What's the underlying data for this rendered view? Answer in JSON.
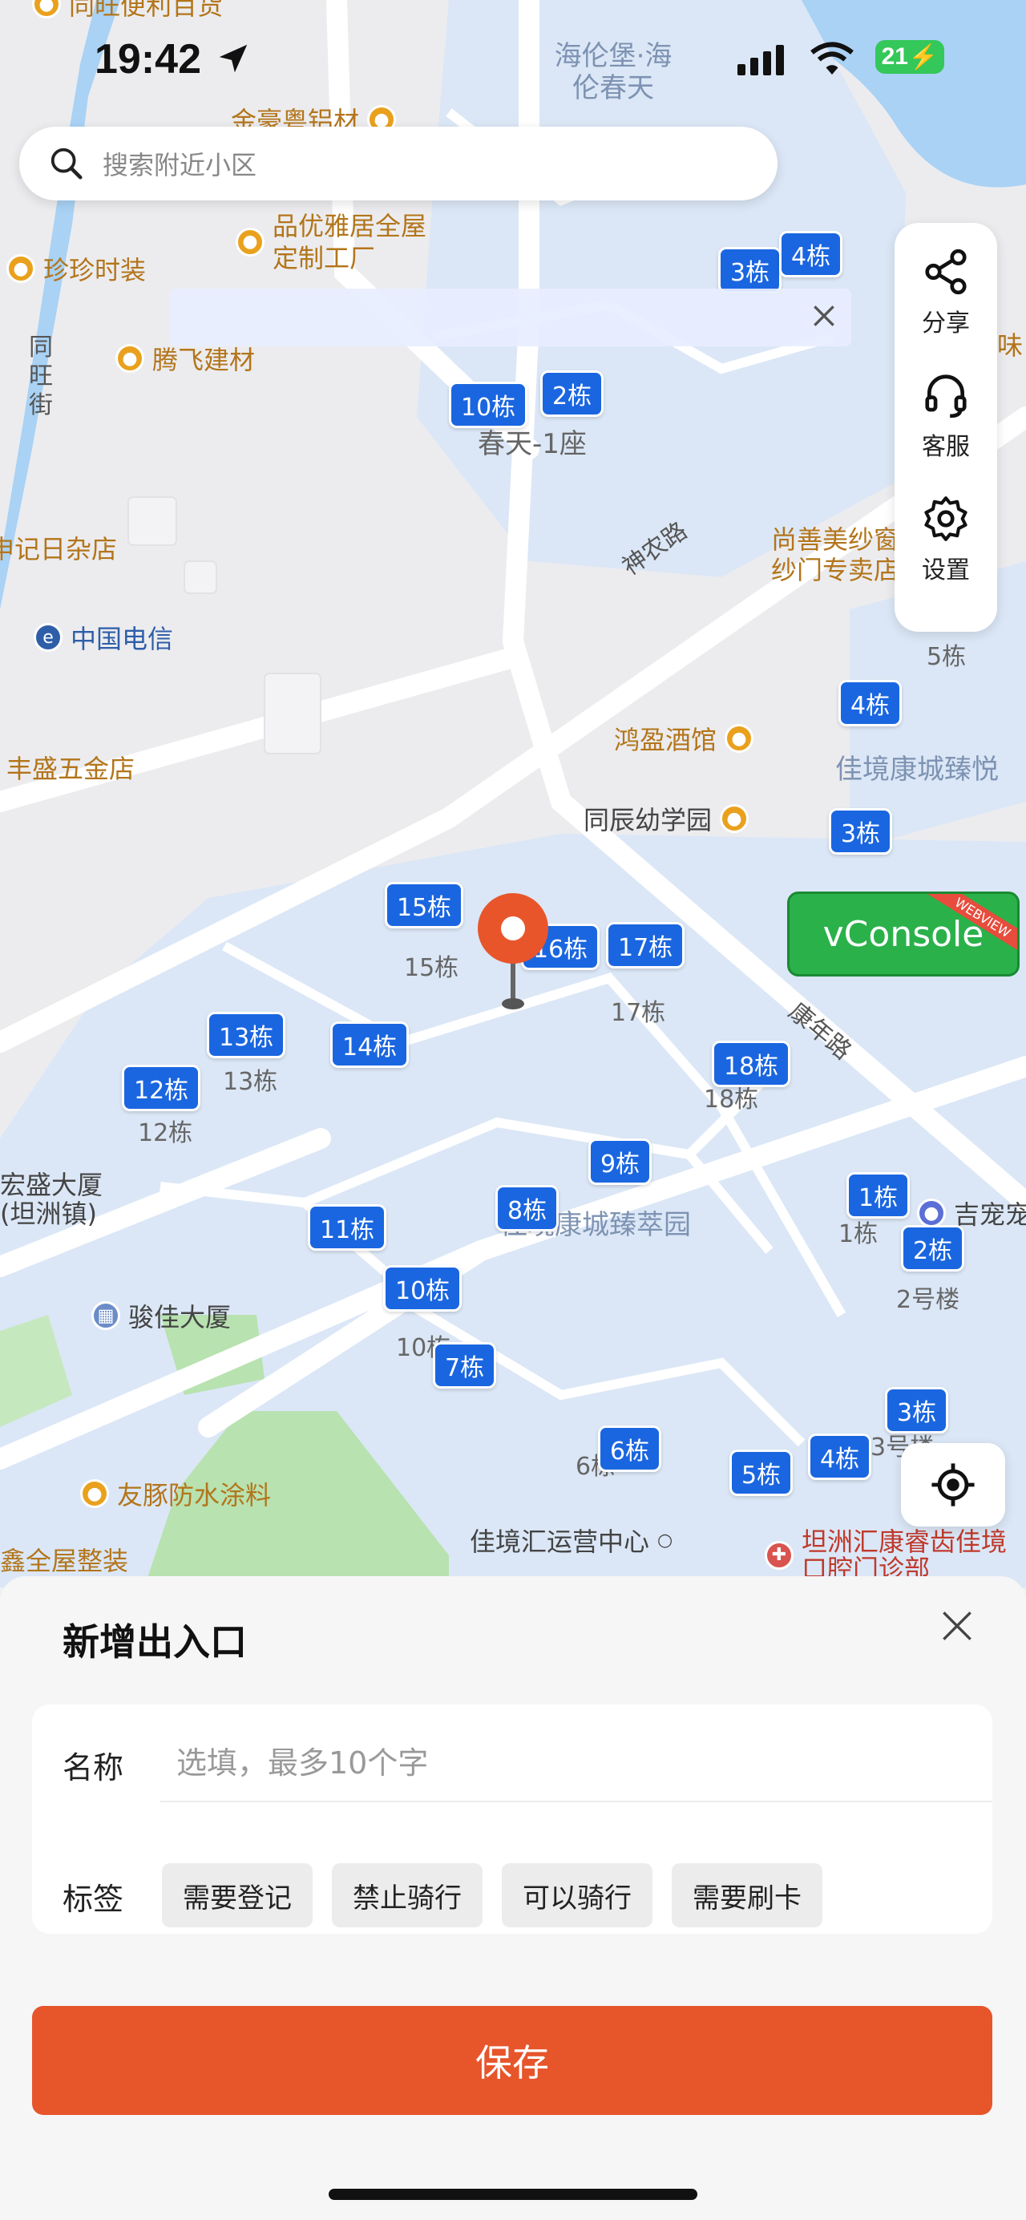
{
  "status_bar": {
    "time": "19:42",
    "battery": "21"
  },
  "search": {
    "placeholder": "搜索附近小区"
  },
  "toolbar": {
    "share": "分享",
    "service": "客服",
    "settings": "设置"
  },
  "vconsole": {
    "label": "vConsole",
    "ribbon": "WEBVIEW"
  },
  "map": {
    "pois": {
      "p1": "同旺便利百货",
      "p2": "金豪粤铝材",
      "p3": "品优雅居全屋定制工厂",
      "p4": "珍珍时装",
      "p5": "腾飞建材",
      "p6": "申记日杂店",
      "p7": "中国电信",
      "p8": "丰盛五金店",
      "p9": "鸿盈酒馆",
      "p10": "同辰幼学园",
      "p11": "宏盛大厦(坦洲镇)",
      "p12": "骏佳大厦",
      "p13": "友豚防水涂料",
      "p14": "鑫全屋整装",
      "p15": "佳境汇运营中心",
      "p16": "坦洲汇康睿齿佳境口腔门诊部",
      "p17": "尚善美纱窗纱门专卖店",
      "p18": "吉宠宠",
      "p19": "味"
    },
    "areas": {
      "a1": "海伦堡·海伦春天",
      "a2": "佳境康城臻悦",
      "a3": "佳境康城臻萃园",
      "a4": "春天-1座"
    },
    "roads": {
      "r1": "同旺街",
      "r2": "神农路",
      "r3": "康年路"
    },
    "buildings": {
      "b1": "15栋",
      "b2": "16栋",
      "b3": "17栋",
      "b4": "13栋",
      "b5": "14栋",
      "b6": "12栋",
      "b7": "18栋",
      "b8": "9栋",
      "b9": "8栋",
      "b10": "11栋",
      "b11": "10栋",
      "b12": "7栋",
      "b13": "6栋",
      "b14": "5栋",
      "b15": "4栋",
      "b16": "3栋",
      "b17": "1栋",
      "b18": "2栋",
      "b19": "3栋",
      "b20": "4栋",
      "b21": "10栋",
      "b22": "2栋",
      "b23": "3栋",
      "b24": "4栋",
      "b25": "5栋"
    },
    "building_subs": {
      "s1": "15栋",
      "s2": "17栋",
      "s3": "13栋",
      "s4": "12栋",
      "s5": "18栋",
      "s6": "10栋",
      "s7": "6栋",
      "s8": "1栋",
      "s9": "2号楼",
      "s10": "3号楼",
      "s11": "5栋"
    }
  },
  "sheet": {
    "title": "新增出入口",
    "name_label": "名称",
    "name_placeholder": "选填，最多10个字",
    "name_value": "",
    "tag_label": "标签",
    "tags": [
      "需要登记",
      "禁止骑行",
      "可以骑行",
      "需要刷卡"
    ],
    "save_label": "保存"
  }
}
